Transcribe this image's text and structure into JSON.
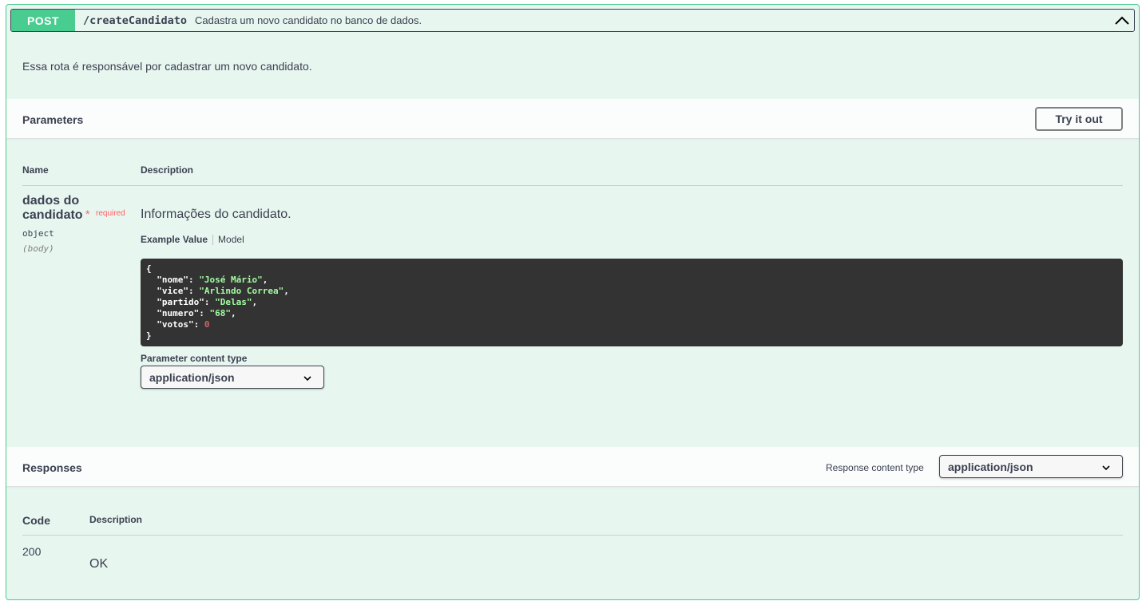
{
  "operation": {
    "method": "POST",
    "path": "/createCandidato",
    "summary": "Cadastra um novo candidato no banco de dados.",
    "description": "Essa rota é responsável por cadastrar um novo candidato."
  },
  "parameters": {
    "title": "Parameters",
    "try_button": "Try it out",
    "col_name": "Name",
    "col_description": "Description",
    "param": {
      "name": "dados do candidato",
      "required_star": "*",
      "required_label": "required",
      "type": "object",
      "in": "(body)",
      "description": "Informações do candidato.",
      "tab_example": "Example Value",
      "tab_model": "Model",
      "example": {
        "nome": "José Mário",
        "vice": "Arlindo Correa",
        "partido": "Delas",
        "numero": "68",
        "votos": 0
      }
    },
    "content_type_label": "Parameter content type",
    "content_type_value": "application/json"
  },
  "responses": {
    "title": "Responses",
    "content_type_label": "Response content type",
    "content_type_value": "application/json",
    "col_code": "Code",
    "col_description": "Description",
    "rows": [
      {
        "code": "200",
        "description": "OK"
      }
    ]
  },
  "icons": {
    "collapse": "chevron-up-icon",
    "select": "chevron-down-icon"
  },
  "colors": {
    "post_accent": "#49cc90",
    "block_bg": "#e8f6f0",
    "code_bg": "#333333",
    "code_string": "#a2fca2",
    "code_number": "#d36363",
    "required": "#ff6060"
  }
}
